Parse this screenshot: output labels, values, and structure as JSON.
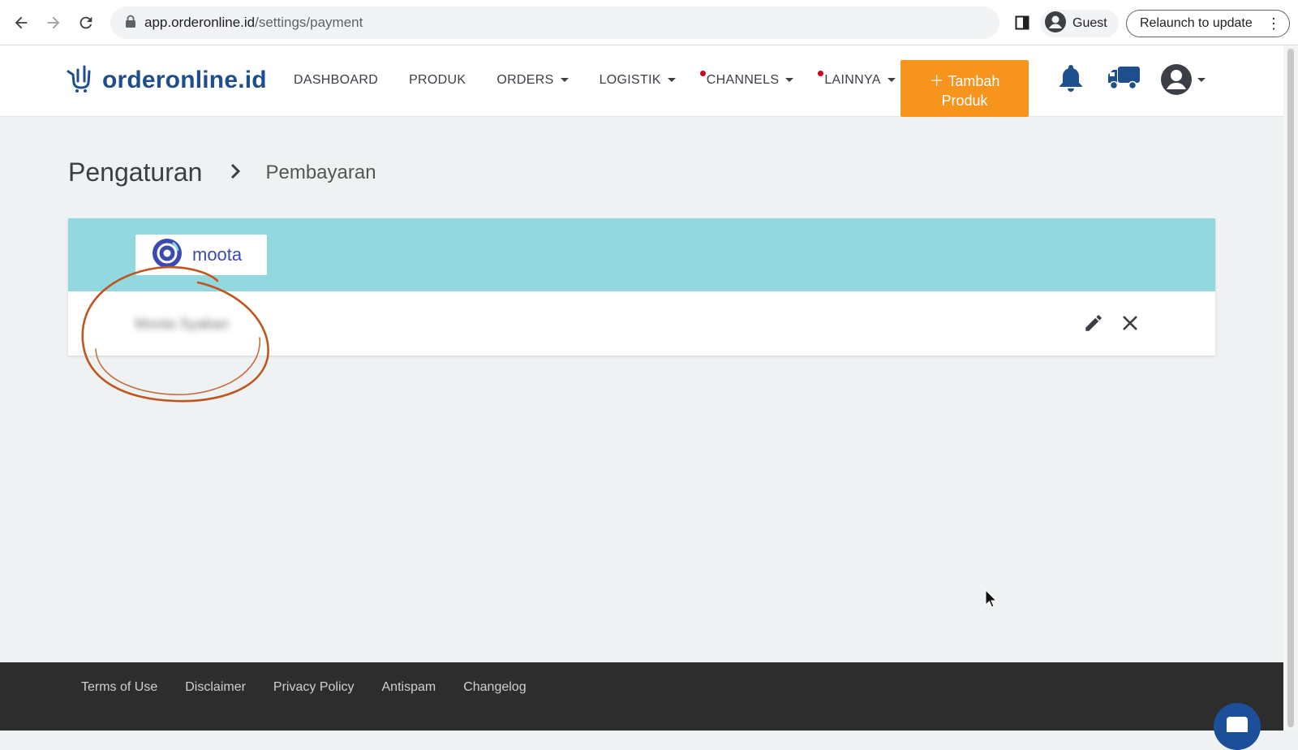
{
  "browser": {
    "url_host": "app.orderonline.id",
    "url_path": "/settings/payment",
    "profile_label": "Guest",
    "relaunch_label": "Relaunch to update"
  },
  "header": {
    "logo_text": "orderonline.id",
    "nav": [
      {
        "label": "DASHBOARD"
      },
      {
        "label": "PRODUK"
      },
      {
        "label": "ORDERS"
      },
      {
        "label": "LOGISTIK"
      },
      {
        "label": "CHANNELS"
      },
      {
        "label": "LAINNYA"
      }
    ],
    "add_button_line1": "Tambah",
    "add_button_line2": "Produk",
    "accent_color": "#f7941d"
  },
  "breadcrumb": {
    "root": "Pengaturan",
    "current": "Pembayaran"
  },
  "payment_card": {
    "brand_name": "moota",
    "account_label": "Moota Syaban",
    "header_color": "#93d7df"
  },
  "footer": {
    "links": [
      "Terms of Use",
      "Disclaimer",
      "Privacy Policy",
      "Antispam",
      "Changelog"
    ]
  },
  "icons": [
    "back-icon",
    "forward-icon",
    "reload-icon",
    "lock-icon",
    "side-panel-icon",
    "account-icon",
    "bell-icon",
    "truck-icon",
    "user-avatar-icon",
    "edit-icon",
    "close-icon",
    "chat-icon"
  ]
}
